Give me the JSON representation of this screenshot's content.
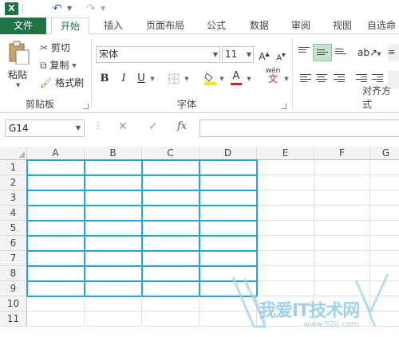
{
  "qat": {
    "app_icon": "X",
    "undo_icon": "undo-icon",
    "redo_icon": "redo-icon"
  },
  "tabs": [
    {
      "label": "文件"
    },
    {
      "label": "开始"
    },
    {
      "label": "插入"
    },
    {
      "label": "页面布局"
    },
    {
      "label": "公式"
    },
    {
      "label": "数据"
    },
    {
      "label": "审阅"
    },
    {
      "label": "视图"
    },
    {
      "label": "自选命"
    }
  ],
  "ribbon": {
    "clipboard": {
      "paste": "粘贴",
      "cut": "剪切",
      "copy": "复制",
      "format_painter": "格式刷",
      "group": "剪贴板"
    },
    "font": {
      "name": "宋体",
      "size": "11",
      "bold": "B",
      "italic": "I",
      "underline": "U",
      "phonetic": "wén",
      "group": "字体"
    },
    "alignment": {
      "group": "对齐方式"
    }
  },
  "formula_bar": {
    "name_box": "G14",
    "cancel": "✕",
    "enter": "✓",
    "fx": "fx",
    "value": ""
  },
  "columns": [
    "A",
    "B",
    "C",
    "D",
    "E",
    "F",
    "G"
  ],
  "rows": [
    "1",
    "2",
    "3",
    "4",
    "5",
    "6",
    "7",
    "8",
    "9",
    "10",
    "11"
  ],
  "colors": {
    "accent": "#217346",
    "table_border": "#1ea6dd",
    "font_color": "#e02020",
    "highlight": "#ffe800"
  },
  "watermark": {
    "text": "我爱IT技术网",
    "url": "www.52ij.com"
  }
}
